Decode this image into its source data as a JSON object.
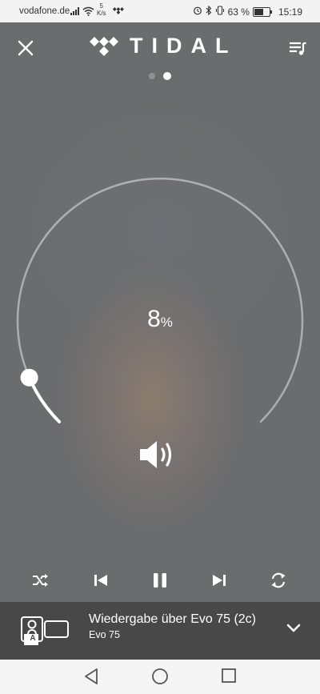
{
  "status_bar": {
    "carrier": "vodafone.de",
    "network_speed_value": "5",
    "network_speed_unit": "K/s",
    "battery_percent_label": "63 %",
    "battery_level": 0.63,
    "time": "15:19"
  },
  "header": {
    "logo_text": "TIDAL",
    "pager_total": 2,
    "pager_active_index": 1
  },
  "volume": {
    "value_number": "8",
    "value_unit": "%",
    "level": 0.08
  },
  "controls": {
    "icons": [
      "shuffle-icon",
      "previous-icon",
      "pause-icon",
      "next-icon",
      "repeat-icon"
    ]
  },
  "device": {
    "title": "Wiedergabe über Evo 75 (2c)",
    "name": "Evo 75",
    "badge": "A"
  },
  "nav": {
    "icons": [
      "back-icon",
      "home-icon",
      "recents-icon"
    ]
  },
  "colors": {
    "device_bar": "#484848",
    "status_bar": "#f3f3f3",
    "accent": "#ffffff"
  }
}
